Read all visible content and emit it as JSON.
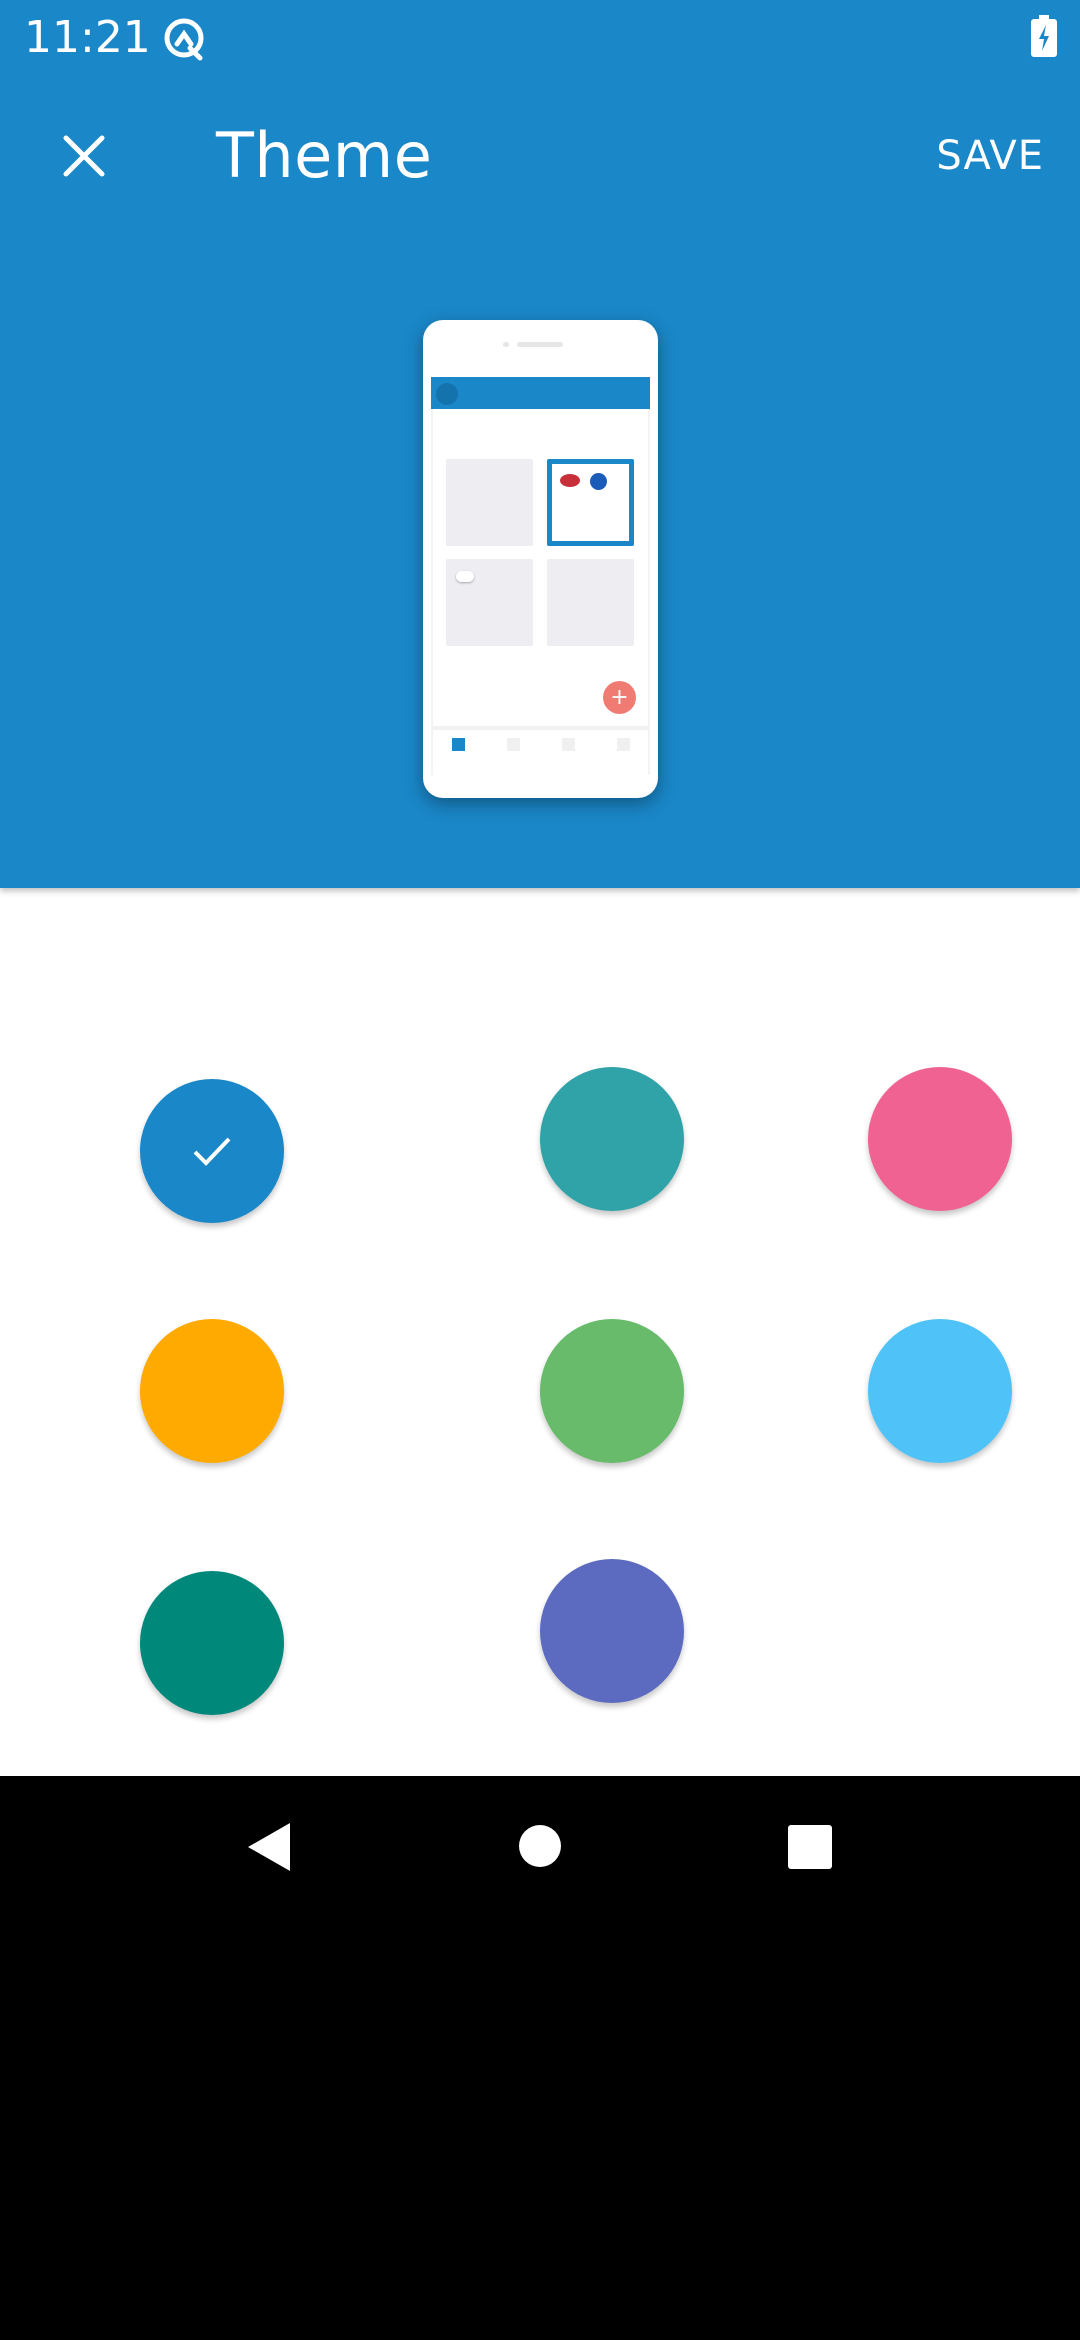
{
  "status_bar": {
    "time": "11:21",
    "app_icon": "data-saver-icon",
    "battery_icon": "battery-charging-icon"
  },
  "app_bar": {
    "close_icon": "close-icon",
    "title": "Theme",
    "save_label": "SAVE",
    "background": "#1A87C8"
  },
  "preview": {
    "fab_symbol": "+"
  },
  "theme_colors": [
    {
      "name": "blue",
      "hex": "#1A87C8",
      "selected": true
    },
    {
      "name": "teal",
      "hex": "#30A3A8",
      "selected": false
    },
    {
      "name": "pink",
      "hex": "#F06292",
      "selected": false
    },
    {
      "name": "amber",
      "hex": "#FFAA00",
      "selected": false
    },
    {
      "name": "green",
      "hex": "#67BB6A",
      "selected": false
    },
    {
      "name": "light-blue",
      "hex": "#4FC3F7",
      "selected": false
    },
    {
      "name": "dark-teal",
      "hex": "#00897B",
      "selected": false
    },
    {
      "name": "indigo",
      "hex": "#5C6BC0",
      "selected": false
    }
  ],
  "nav_bar": {
    "back_icon": "back-icon",
    "home_icon": "home-icon",
    "recents_icon": "recents-icon"
  }
}
